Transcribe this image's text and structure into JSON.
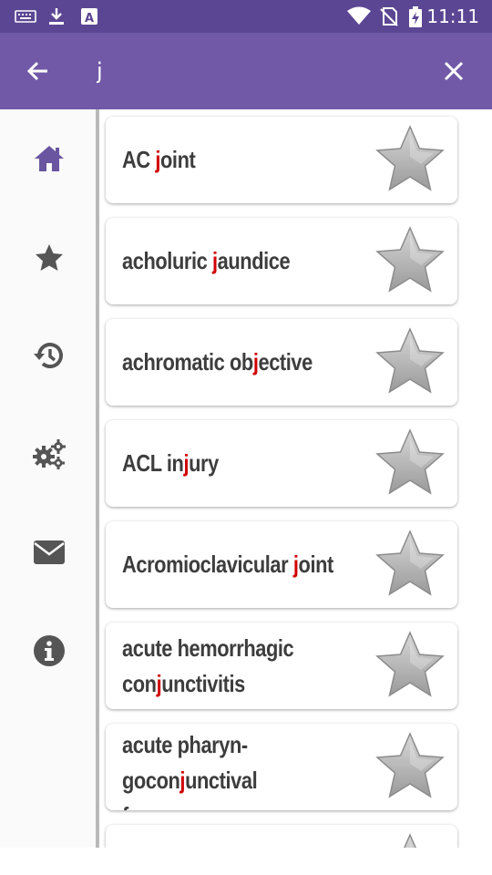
{
  "status_bar": {
    "time": "11:11",
    "icons": [
      "keyboard-icon",
      "download-icon",
      "font-a-icon",
      "wifi-icon",
      "no-sim-icon",
      "battery-charging-icon"
    ]
  },
  "app_bar": {
    "search_query": "j",
    "back_icon": "arrow-left-icon",
    "clear_icon": "close-icon"
  },
  "side_nav": {
    "items": [
      {
        "name": "home",
        "icon": "home-icon",
        "active": true
      },
      {
        "name": "favorites",
        "icon": "star-icon",
        "active": false
      },
      {
        "name": "history",
        "icon": "history-icon",
        "active": false
      },
      {
        "name": "settings",
        "icon": "gears-icon",
        "active": false
      },
      {
        "name": "contact",
        "icon": "envelope-icon",
        "active": false
      },
      {
        "name": "about",
        "icon": "info-icon",
        "active": false
      }
    ]
  },
  "results": [
    {
      "before": "AC ",
      "match": "j",
      "after": "oint"
    },
    {
      "before": "acholuric ",
      "match": "j",
      "after": "aundice"
    },
    {
      "before": "achromatic ob",
      "match": "j",
      "after": "ective"
    },
    {
      "before": "ACL in",
      "match": "j",
      "after": "ury"
    },
    {
      "before": "Acromioclavicular ",
      "match": "j",
      "after": "oint"
    },
    {
      "before": "acute hemorrhagic con",
      "match": "j",
      "after": "unctivitis"
    },
    {
      "before": "acute pharyn- gocon",
      "match": "j",
      "after": "unctival fever"
    }
  ],
  "colors": {
    "status_bar": "#5b4693",
    "app_bar": "#7159a7",
    "nav_active": "#6a55a0",
    "nav_inactive": "#555555",
    "highlight": "#d10000",
    "term_text": "#3d3d3d"
  }
}
